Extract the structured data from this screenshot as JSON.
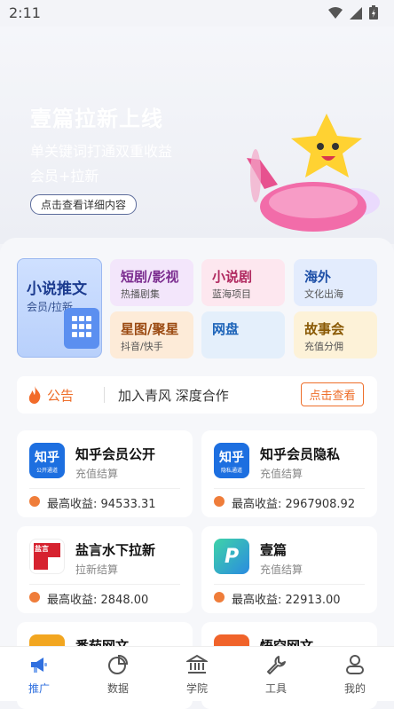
{
  "status_bar": {
    "time": "2:11"
  },
  "banner": {
    "title": "壹篇拉新上线",
    "subtitle": "单关键词打通双重收益",
    "subtitle2": "会员+拉新",
    "button": "点击查看详细内容"
  },
  "categories": [
    {
      "title": "小说推文",
      "sub": "会员/拉新",
      "color": "#1c3b8f"
    },
    {
      "title": "短剧/影视",
      "sub": "热播剧集",
      "color": "#7b2c8f"
    },
    {
      "title": "小说剧",
      "sub": "蓝海项目",
      "color": "#b0285f"
    },
    {
      "title": "海外",
      "sub": "文化出海",
      "color": "#1d4fa7"
    },
    {
      "title": "星图/聚星",
      "sub": "抖音/快手",
      "color": "#9b4a12"
    },
    {
      "title": "网盘",
      "sub": "",
      "color": "#1d64b9"
    },
    {
      "title": "故事会",
      "sub": "充值分佣",
      "color": "#8a5a05"
    }
  ],
  "announcement": {
    "label": "公告",
    "text": "加入青风 深度合作",
    "button": "点击查看"
  },
  "earnings_label": "最高收益:",
  "projects": [
    {
      "name": "知乎会员公开",
      "mode": "充值结算",
      "earning": "94533.31",
      "logo_text": "知乎",
      "logo_sub": "公开通道",
      "logo_color": "#1d6fe0"
    },
    {
      "name": "知乎会员隐私",
      "mode": "充值结算",
      "earning": "2967908.92",
      "logo_text": "知乎",
      "logo_sub": "隐私通道",
      "logo_color": "#1d6fe0"
    },
    {
      "name": "盐言水下拉新",
      "mode": "拉新结算",
      "earning": "2848.00",
      "logo_text": "盐言",
      "logo_sub": "",
      "logo_color": "#d6222f"
    },
    {
      "name": "壹篇",
      "mode": "充值结算",
      "earning": "22913.00",
      "logo_text": "P",
      "logo_sub": "",
      "logo_color": "#2bb6c9"
    },
    {
      "name": "番茄网文",
      "mode": "",
      "earning": "",
      "logo_text": "",
      "logo_sub": "",
      "logo_color": "#f2a620"
    },
    {
      "name": "悟空网文",
      "mode": "",
      "earning": "",
      "logo_text": "",
      "logo_sub": "",
      "logo_color": "#f0632a"
    }
  ],
  "tabs": [
    {
      "label": "推广",
      "icon": "megaphone-icon",
      "active": true
    },
    {
      "label": "数据",
      "icon": "pie-chart-icon",
      "active": false
    },
    {
      "label": "学院",
      "icon": "bank-icon",
      "active": false
    },
    {
      "label": "工具",
      "icon": "wrench-icon",
      "active": false
    },
    {
      "label": "我的",
      "icon": "user-icon",
      "active": false
    }
  ],
  "colors": {
    "accent": "#2f6fdf",
    "orange": "#ee6e2a"
  }
}
